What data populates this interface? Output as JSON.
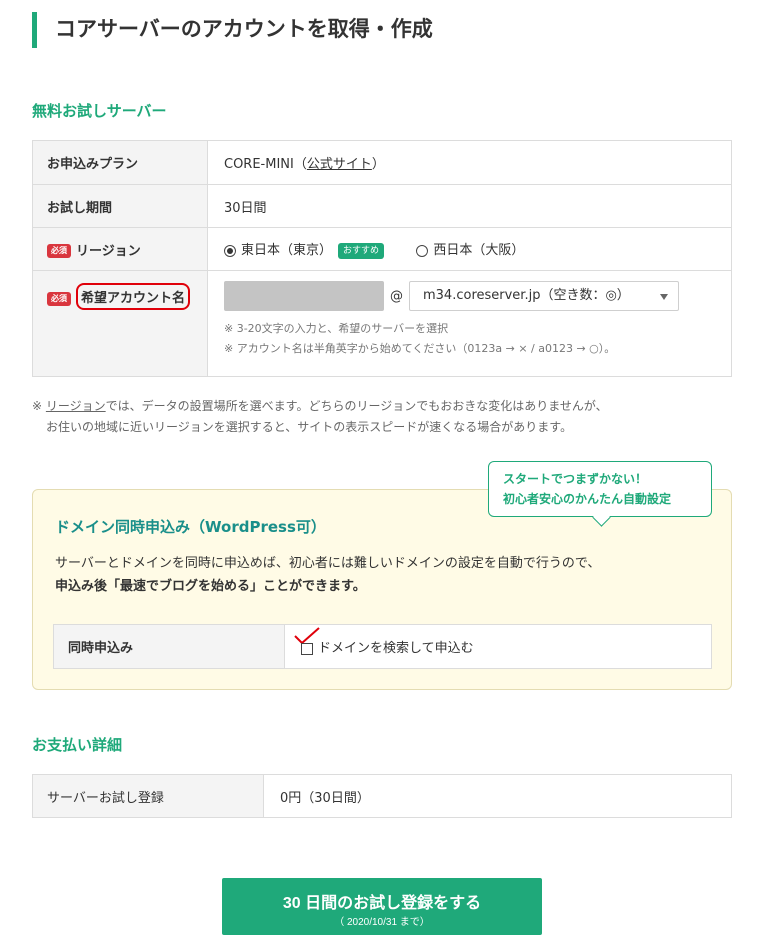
{
  "page_title": "コアサーバーのアカウントを取得・作成",
  "trial_section": {
    "title": "無料お試しサーバー",
    "plan": {
      "label": "お申込みプラン",
      "value": "CORE-MINI（",
      "link": "公式サイト",
      "suffix": "）"
    },
    "period": {
      "label": "お試し期間",
      "value": "30日間"
    },
    "region": {
      "required": "必須",
      "label": "リージョン",
      "options": [
        {
          "label": "東日本（東京）",
          "selected": true,
          "badge": "おすすめ"
        },
        {
          "label": "西日本（大阪）",
          "selected": false
        }
      ]
    },
    "account": {
      "required": "必須",
      "label": "希望アカウント名",
      "input_value": "",
      "at": "@",
      "server_select": "m34.coreserver.jp（空き数：◎）",
      "hints": [
        "※ 3-20文字の入力と、希望のサーバーを選択",
        "※ アカウント名は半角英字から始めてください（0123a → × / a0123 → ○）。"
      ]
    }
  },
  "region_note": {
    "prefix": "※ ",
    "link": "リージョン",
    "line1": "では、データの設置場所を選べます。どちらのリージョンでもおおきな変化はありませんが、",
    "line2": "お住いの地域に近いリージョンを選択すると、サイトの表示スピードが速くなる場合があります。"
  },
  "bubble": {
    "line1": "スタートでつまずかない！",
    "line2": "初心者安心のかんたん自動設定"
  },
  "domain_section": {
    "title": "ドメイン同時申込み（WordPress可）",
    "text_line1": "サーバーとドメインを同時に申込めば、初心者には難しいドメインの設定を自動で行うので、",
    "text_line2": "申込み後「最速でブログを始める」ことができます。",
    "row_label": "同時申込み",
    "checkbox_label": "ドメインを検索して申込む",
    "checked": false
  },
  "payment_section": {
    "title": "お支払い詳細",
    "label": "サーバーお試し登録",
    "value": "0円（30日間）"
  },
  "submit": {
    "main": "30 日間のお試し登録をする",
    "sub": "（ 2020/10/31 まで）"
  },
  "colors": {
    "accent": "#1fa97a",
    "required": "#d9363e",
    "highlight": "#e0000a",
    "yellow_bg": "#fffbe6"
  }
}
